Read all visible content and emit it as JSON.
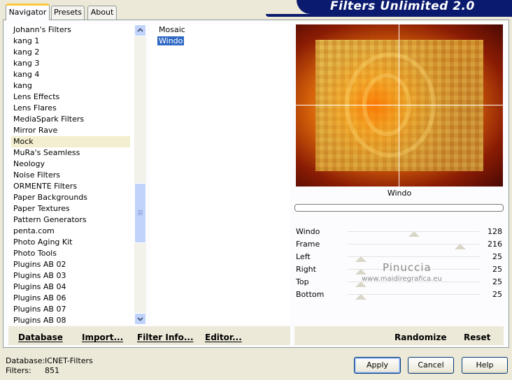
{
  "app": {
    "title": "Filters Unlimited 2.0"
  },
  "tabs": [
    {
      "label": "Navigator",
      "active": true
    },
    {
      "label": "Presets",
      "active": false
    },
    {
      "label": "About",
      "active": false
    }
  ],
  "categories": {
    "items": [
      "Johann's Filters",
      "kang 1",
      "kang 2",
      "kang 3",
      "kang 4",
      "kang",
      "Lens Effects",
      "Lens Flares",
      "MediaSpark Filters",
      "Mirror Rave",
      "Mock",
      "MuRa's Seamless",
      "Neology",
      "Noise Filters",
      "ORMENTE Filters",
      "Paper Backgrounds",
      "Paper Textures",
      "Pattern Generators",
      "penta.com",
      "Photo Aging Kit",
      "Photo Tools",
      "Plugins AB 02",
      "Plugins AB 03",
      "Plugins AB 04",
      "Plugins AB 06",
      "Plugins AB 07",
      "Plugins AB 08"
    ],
    "selected": "Mock"
  },
  "filters": {
    "items": [
      "Mosaic",
      "Windo"
    ],
    "selected": "Windo"
  },
  "left_buttons": {
    "database": "Database",
    "import": "Import...",
    "filter_info": "Filter Info...",
    "editor": "Editor..."
  },
  "preview": {
    "caption": "Windo"
  },
  "parameters": [
    {
      "label": "Windo",
      "value": "128",
      "fraction": 0.5
    },
    {
      "label": "Frame",
      "value": "216",
      "fraction": 0.85
    },
    {
      "label": "Left",
      "value": "25",
      "fraction": 0.1
    },
    {
      "label": "Right",
      "value": "25",
      "fraction": 0.1
    },
    {
      "label": "Top",
      "value": "25",
      "fraction": 0.1
    },
    {
      "label": "Bottom",
      "value": "25",
      "fraction": 0.1
    }
  ],
  "right_buttons": {
    "randomize": "Randomize",
    "reset": "Reset"
  },
  "watermark": {
    "name": "Pinuccia",
    "url": "www.maidiregrafica.eu"
  },
  "footer": {
    "database_label": "Database:",
    "database_value": "ICNET-Filters",
    "filters_label": "Filters:",
    "filters_value": "851"
  },
  "dialog_buttons": {
    "apply": "Apply",
    "cancel": "Cancel",
    "help": "Help"
  }
}
